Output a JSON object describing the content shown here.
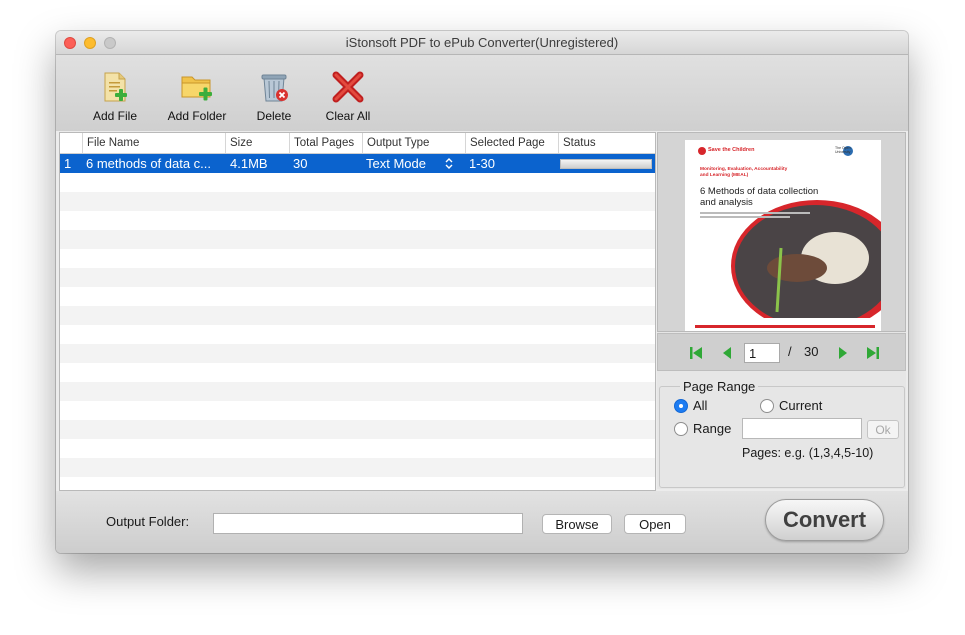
{
  "window": {
    "title": "iStonsoft PDF to ePub Converter(Unregistered)"
  },
  "toolbar": {
    "add_file": "Add File",
    "add_folder": "Add Folder",
    "delete": "Delete",
    "clear_all": "Clear All"
  },
  "table": {
    "headers": [
      "File Name",
      "Size",
      "Total Pages",
      "Output Type",
      "Selected Page",
      "Status"
    ],
    "rows": [
      {
        "index": "1",
        "file_name": "6 methods of data c...",
        "size": "4.1MB",
        "total_pages": "30",
        "output_type": "Text Mode",
        "selected_page": "1-30",
        "status": ""
      }
    ]
  },
  "preview": {
    "org": "Save the Children",
    "subtitle": "Monitoring, Evaluation, Accountability and Learning (MEAL)",
    "title": "6 Methods of data collection and analysis",
    "university": "The Open University"
  },
  "navigation": {
    "current_page": "1",
    "separator": "/",
    "total_pages": "30"
  },
  "page_range": {
    "title": "Page Range",
    "all_label": "All",
    "current_label": "Current",
    "range_label": "Range",
    "ok_label": "Ok",
    "range_value": "",
    "hint": "Pages: e.g. (1,3,4,5-10)",
    "selected": "All"
  },
  "bottom": {
    "output_folder_label": "Output Folder:",
    "output_folder_value": "",
    "browse_label": "Browse",
    "open_label": "Open",
    "convert_label": "Convert"
  },
  "colors": {
    "selection": "#0b63ce",
    "radio_on": "#1d7cf2",
    "close": "#fc5f57",
    "minimize": "#fdbc2e"
  }
}
